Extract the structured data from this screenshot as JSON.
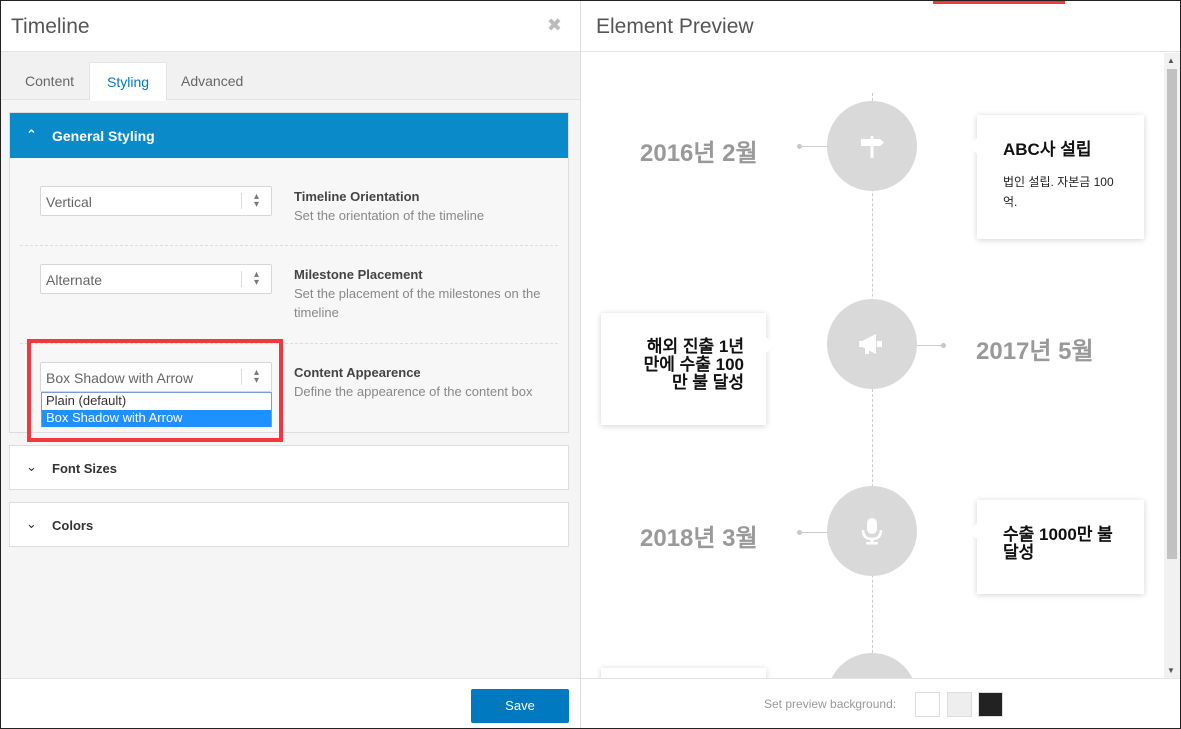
{
  "left": {
    "title": "Timeline",
    "close_icon": "close-icon",
    "tabs": [
      {
        "label": "Content"
      },
      {
        "label": "Styling"
      },
      {
        "label": "Advanced"
      }
    ],
    "general": {
      "label": "General Styling",
      "rows": [
        {
          "value": "Vertical",
          "title": "Timeline Orientation",
          "desc": "Set the orientation of the timeline"
        },
        {
          "value": "Alternate",
          "title": "Milestone Placement",
          "desc": "Set the placement of the milestones on the timeline"
        },
        {
          "value": "Box Shadow with Arrow",
          "title": "Content Appearence",
          "desc": "Define the appearence of the content box"
        }
      ],
      "dropdown_options": [
        "Plain (default)",
        "Box Shadow with Arrow"
      ]
    },
    "font_sizes_label": "Font Sizes",
    "colors_label": "Colors",
    "save_label": "Save"
  },
  "right": {
    "title": "Element Preview",
    "milestones": [
      {
        "date": "2016년 2월",
        "title": "ABC사 설립",
        "body": "법인 설립. 자본금 100억.",
        "icon": "signpost-icon"
      },
      {
        "date": "2017년 5월",
        "title": "해외 진출 1년 만에 수출 100 만 불 달성",
        "body": "",
        "icon": "megaphone-icon"
      },
      {
        "date": "2018년 3월",
        "title": "수출 1000만 불 달성",
        "body": "",
        "icon": "microphone-icon"
      }
    ],
    "bg_label": "Set preview background:",
    "bg_colors": [
      "#ffffff",
      "#eeeeee",
      "#222222"
    ]
  }
}
